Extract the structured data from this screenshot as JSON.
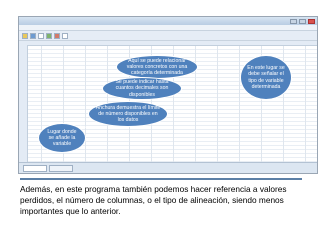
{
  "screenshot": {
    "window_controls": [
      "minimize-icon",
      "maximize-icon",
      "close-icon"
    ],
    "toolbar_icons": [
      "open-icon",
      "save-icon",
      "print-icon",
      "chart-icon",
      "undo-icon",
      "redo-icon"
    ]
  },
  "callouts": {
    "values": "Aquí se puede relacionar valores concretos con una categoría determinada",
    "decimals": "Se puede indicar hasta cuantos decimales son disponibles",
    "width": "Anchura demuestra el límite de número disponibles en los datos",
    "variable_location": "Lugar donde se añade la variable",
    "type": "En este lugar se debe señalar el tipo de variable determinada"
  },
  "caption": {
    "text": "Además, en este programa también podemos hacer referencia a valores perdidos, el número de columnas, o el tipo de alineación, siendo menos importantes que lo anterior."
  },
  "colors": {
    "callout_fill": "#4f81bd",
    "callout_text": "#ffffff",
    "caption_text": "#000000"
  }
}
